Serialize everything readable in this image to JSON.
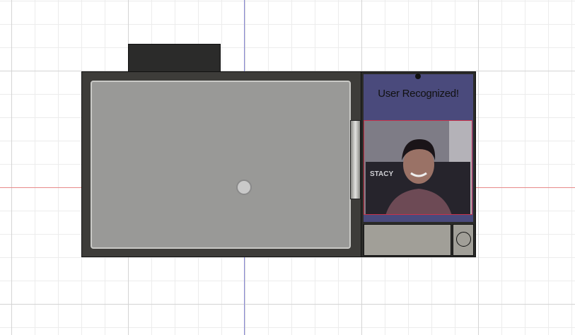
{
  "viewport": {
    "background": "#ffffff",
    "x_axis_color": "#e88a8a",
    "y_axis_color": "#8a8ad8"
  },
  "device": {
    "body_color": "#3d3c39",
    "screen_color": "#a0a09e",
    "display": {
      "background": "#4a4a7c",
      "message": "User Recognized!",
      "photo_border": "#c8324a",
      "photo_label": "STACY",
      "photo_icon": "person-photo"
    },
    "controls": {
      "button_icon": "circle-button"
    }
  }
}
